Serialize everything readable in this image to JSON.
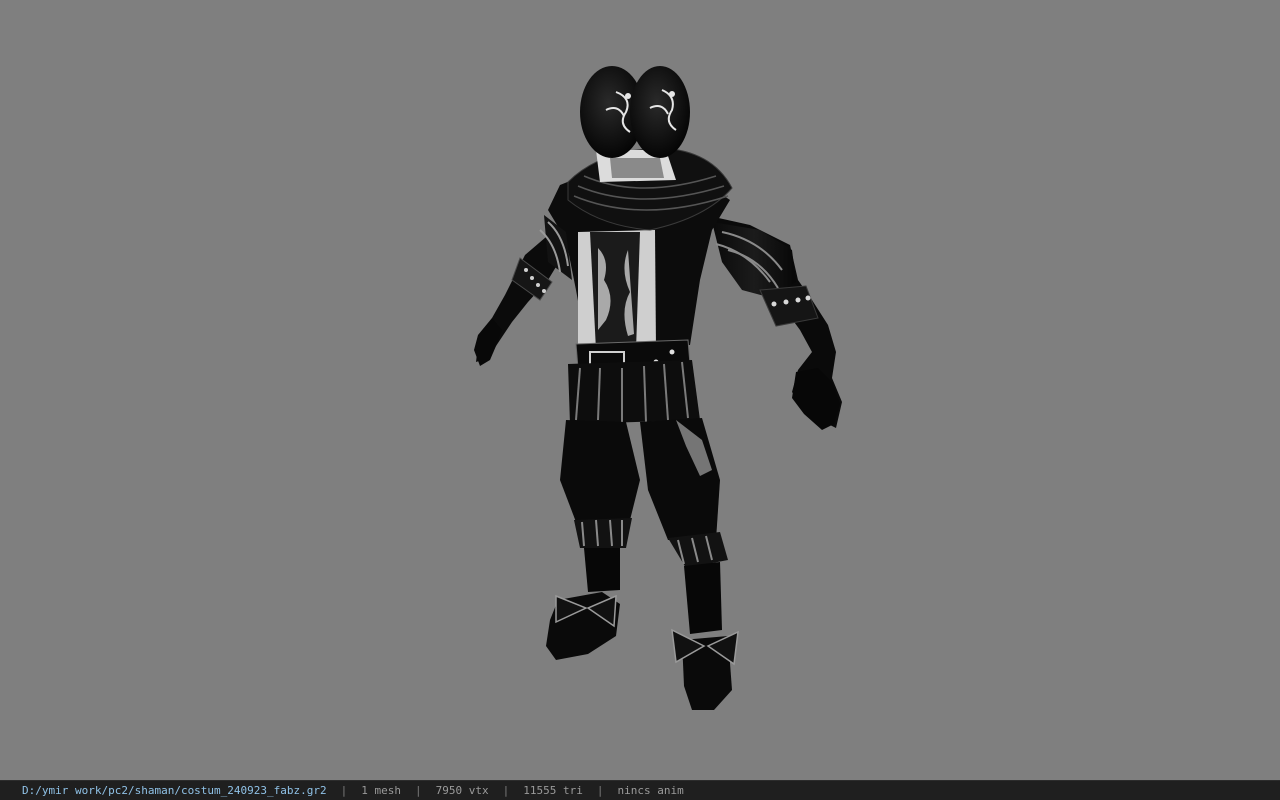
{
  "viewport": {
    "background_color": "#7f7f7f",
    "model_name": "costum_240923_fabz.gr2"
  },
  "status_bar": {
    "file_path": "D:/ymir work/pc2/shaman/costum_240923_fabz.gr2",
    "separator": "|",
    "mesh_count": "1 mesh",
    "vertex_count": "7950 vtx",
    "triangle_count": "11555 tri",
    "animation_status": "nincs anim",
    "colors": {
      "background": "#1f1f1f",
      "path_text": "#8fc1e6",
      "stat_text": "#9a9a9a"
    }
  }
}
